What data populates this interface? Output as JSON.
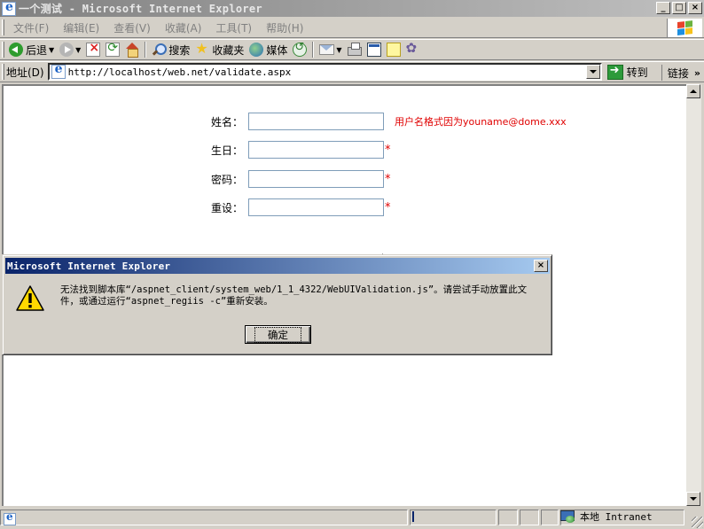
{
  "window": {
    "title": "一个测试 - Microsoft Internet Explorer",
    "minimize": "_",
    "maximize": "□",
    "close": "×"
  },
  "menu": {
    "items": [
      "文件(F)",
      "编辑(E)",
      "查看(V)",
      "收藏(A)",
      "工具(T)",
      "帮助(H)"
    ]
  },
  "toolbar": {
    "back_label": "后退",
    "search_label": "搜索",
    "favorites_label": "收藏夹",
    "media_label": "媒体"
  },
  "address": {
    "label": "地址(D)",
    "url": "http://localhost/web.net/validate.aspx",
    "go_label": "转到",
    "links_label": "链接",
    "links_chevron": "»"
  },
  "form": {
    "name_label": "姓名：",
    "name_value": "",
    "name_hint": "用户名格式因为youname@dome.xxx",
    "birthday_label": "生日：",
    "birthday_value": "",
    "password_label": "密码：",
    "password_value": "",
    "reset_label": "重设：",
    "reset_value": "",
    "required_mark": "*"
  },
  "dialog": {
    "title": "Microsoft Internet Explorer",
    "close": "×",
    "message_line1": "无法找到脚本库“/aspnet_client/system_web/1_1_4322/WebUIValidation.js”。请尝试手动放置此文",
    "message_line2": "件，或通过运行“aspnet_regiis -c”重新安装。",
    "ok_label": "确定"
  },
  "status": {
    "zone_label": "本地 Intranet"
  }
}
